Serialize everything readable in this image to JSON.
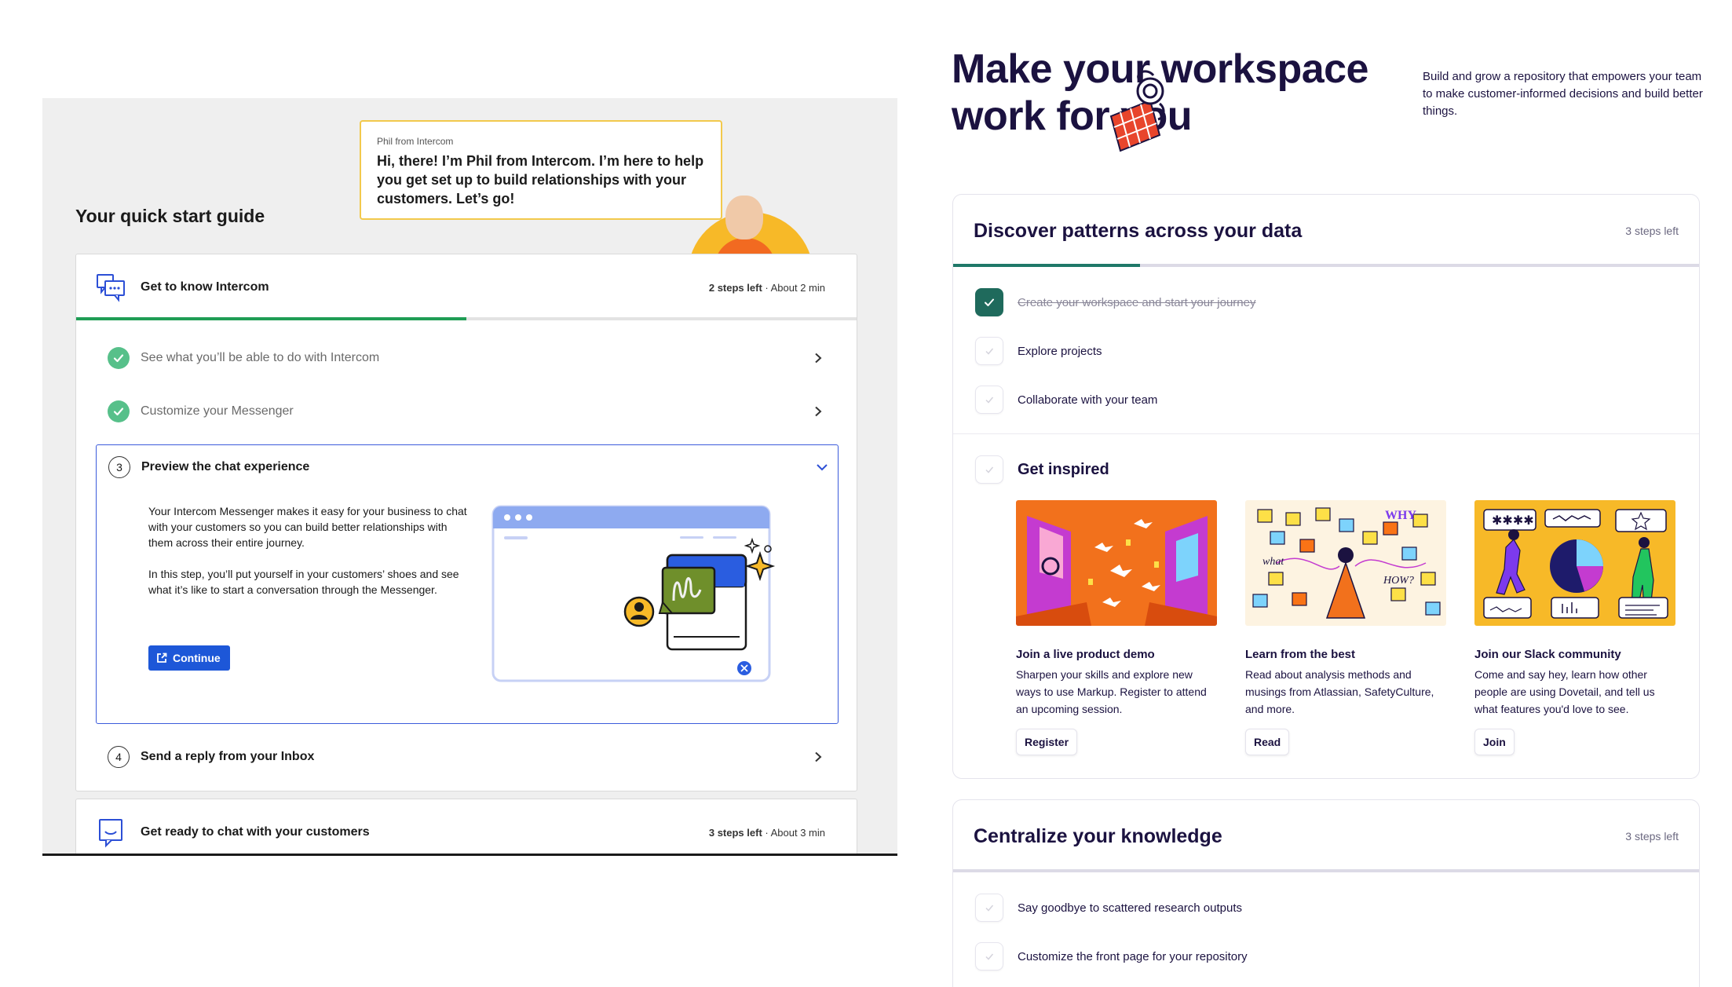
{
  "intercom": {
    "guide_title": "Your quick start guide",
    "bubble": {
      "from": "Phil from Intercom",
      "message": "Hi, there! I’m Phil from Intercom. I’m here to help you get set up to build relationships with your customers. Let’s go!"
    },
    "section1": {
      "title": "Get to know Intercom",
      "steps_left": "2 steps left",
      "duration": " · About 2 min",
      "progress": 0.5,
      "steps": [
        {
          "label": "See what you’ll be able to do with Intercom",
          "status": "done"
        },
        {
          "label": "Customize your Messenger",
          "status": "done"
        },
        {
          "number": "3",
          "label": "Preview the chat experience",
          "status": "open"
        },
        {
          "number": "4",
          "label": "Send a reply from your Inbox",
          "status": "todo"
        }
      ],
      "open_step": {
        "para1": "Your Intercom Messenger makes it easy for your business to chat with your customers so you can build better relationships with them across their entire journey.",
        "para2": "In this step, you’ll put yourself in your customers’ shoes and see what it’s like to start a conversation through the Messenger.",
        "button": "Continue"
      }
    },
    "section2": {
      "title": "Get ready to chat with your customers",
      "steps_left": "3 steps left",
      "duration": " · About 3 min"
    }
  },
  "dovetail": {
    "hero_line1": "Make your workspace",
    "hero_line2": "work for you",
    "hero_sub": "Build and grow a repository that empowers your team to make customer-informed decisions and build better things.",
    "card1": {
      "title": "Discover patterns across your data",
      "steps_left": "3 steps left",
      "progress": 0.25,
      "tasks": [
        {
          "label": "Create your workspace and start your journey",
          "done": true
        },
        {
          "label": "Explore projects",
          "done": false
        },
        {
          "label": "Collaborate with your team",
          "done": false
        }
      ],
      "inspired": "Get inspired",
      "tiles": [
        {
          "title": "Join a live product demo",
          "desc": "Sharpen your skills and explore new ways to use Markup. Register to attend an upcoming session.",
          "button": "Register"
        },
        {
          "title": "Learn from the best",
          "desc": "Read about analysis methods and musings from Atlassian, SafetyCulture, and more.",
          "button": "Read"
        },
        {
          "title": "Join our Slack community",
          "desc": "Come and say hey, learn how other people are using Dovetail, and tell us what features you'd love to see.",
          "button": "Join"
        }
      ],
      "tile2_words": {
        "why": "WHY",
        "what": "what",
        "how": "HOW?"
      }
    },
    "card2": {
      "title": "Centralize your knowledge",
      "steps_left": "3 steps left",
      "tasks": [
        {
          "label": "Say goodbye to scattered research outputs",
          "done": false
        },
        {
          "label": "Customize the front page for your repository",
          "done": false
        }
      ]
    }
  }
}
